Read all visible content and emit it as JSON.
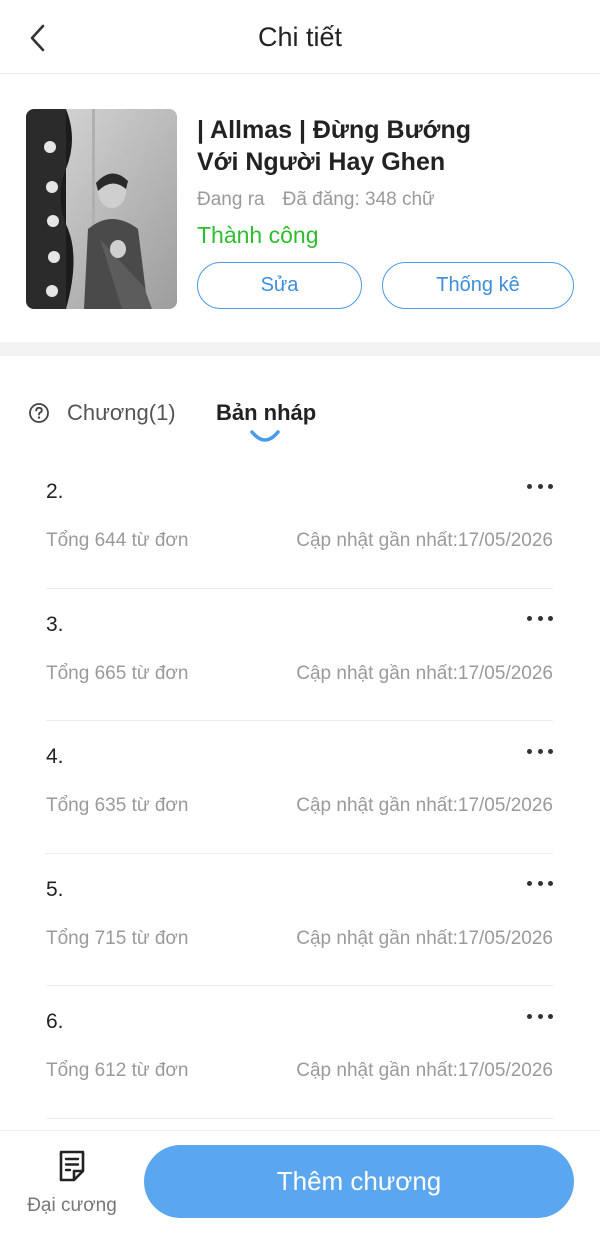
{
  "header": {
    "title": "Chi tiết",
    "back_icon": "chevron-left-icon"
  },
  "book": {
    "title_line1": "| Allmas | Đừng Bướng",
    "title_line2": "Với Người Hay Ghen",
    "status_label": "Đang ra",
    "published_label": "Đã đăng: 348 chữ",
    "result": "Thành công",
    "result_color": "#2ebd2e",
    "edit_label": "Sửa",
    "stats_label": "Thống kê",
    "accent_color": "#4a9be8"
  },
  "tabs": {
    "chapters_label": "Chương(1)",
    "drafts_label": "Bản nháp",
    "help_icon": "question-circle-icon"
  },
  "drafts": [
    {
      "number": "2.",
      "words": "Tổng 644 từ đơn",
      "updated": "Cập nhật gần nhất:17/05/2026"
    },
    {
      "number": "3.",
      "words": "Tổng 665 từ đơn",
      "updated": "Cập nhật gần nhất:17/05/2026"
    },
    {
      "number": "4.",
      "words": "Tổng 635 từ đơn",
      "updated": "Cập nhật gần nhất:17/05/2026"
    },
    {
      "number": "5.",
      "words": "Tổng 715 từ đơn",
      "updated": "Cập nhật gần nhất:17/05/2026"
    },
    {
      "number": "6.",
      "words": "Tổng 612 từ đơn",
      "updated": "Cập nhật gần nhất:17/05/2026"
    }
  ],
  "bottom": {
    "outline_label": "Đại cương",
    "outline_icon": "document-icon",
    "add_chapter_label": "Thêm chương",
    "add_button_color": "#5aa7f0"
  }
}
